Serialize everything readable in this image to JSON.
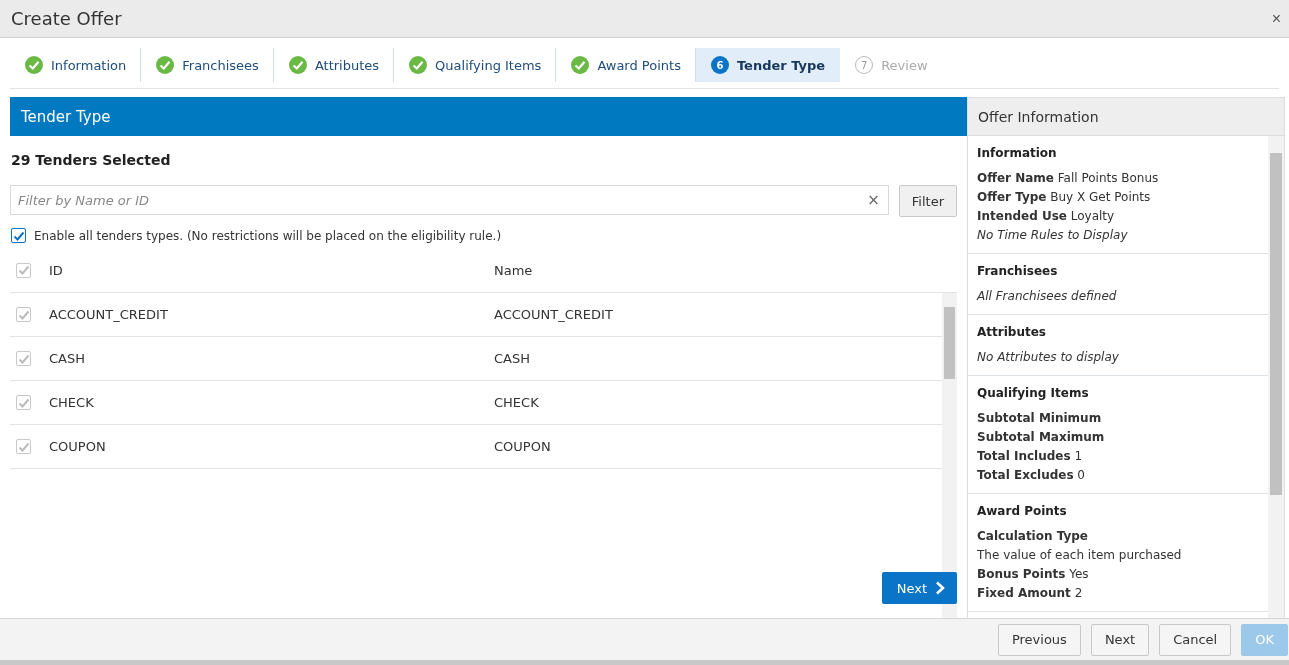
{
  "dialog": {
    "title": "Create Offer",
    "close": "×"
  },
  "steps": [
    {
      "label": "Information",
      "kind": "done",
      "selected": false
    },
    {
      "label": "Franchisees",
      "kind": "done",
      "selected": false
    },
    {
      "label": "Attributes",
      "kind": "done",
      "selected": false
    },
    {
      "label": "Qualifying Items",
      "kind": "done",
      "selected": false
    },
    {
      "label": "Award Points",
      "kind": "done",
      "selected": false
    },
    {
      "label": "Tender Type",
      "kind": "current",
      "number": "6",
      "selected": true
    },
    {
      "label": "Review",
      "kind": "pending",
      "number": "7",
      "selected": false
    }
  ],
  "main": {
    "header": "Tender Type",
    "count": "29 Tenders Selected",
    "filter": {
      "placeholder": "Filter by Name or ID",
      "clear": "×",
      "button": "Filter"
    },
    "enable_all": {
      "label": "Enable all tenders types. (No restrictions will be placed on the eligibility rule.)",
      "checked": true
    },
    "table": {
      "columns": [
        "ID",
        "Name"
      ],
      "header_checked": true,
      "rows": [
        {
          "id": "ACCOUNT_CREDIT",
          "name": "ACCOUNT_CREDIT",
          "checked": true
        },
        {
          "id": "CASH",
          "name": "CASH",
          "checked": true
        },
        {
          "id": "CHECK",
          "name": "CHECK",
          "checked": true
        },
        {
          "id": "COUPON",
          "name": "COUPON",
          "checked": true
        }
      ]
    },
    "next": "Next"
  },
  "offer_info": {
    "title": "Offer Information",
    "sections": [
      {
        "title": "Information",
        "lines": [
          {
            "kind": "pair",
            "label": "Offer Name",
            "value": "Fall Points Bonus"
          },
          {
            "kind": "pair",
            "label": "Offer Type",
            "value": "Buy X Get Points"
          },
          {
            "kind": "pair",
            "label": "Intended Use",
            "value": "Loyalty"
          },
          {
            "kind": "note",
            "text": "No Time Rules to Display"
          }
        ]
      },
      {
        "title": "Franchisees",
        "lines": [
          {
            "kind": "note",
            "text": "All Franchisees defined"
          }
        ]
      },
      {
        "title": "Attributes",
        "lines": [
          {
            "kind": "note",
            "text": "No Attributes to display"
          }
        ]
      },
      {
        "title": "Qualifying Items",
        "lines": [
          {
            "kind": "pair",
            "label": "Subtotal Minimum"
          },
          {
            "kind": "pair",
            "label": "Subtotal Maximum"
          },
          {
            "kind": "pair",
            "label": "Total Includes",
            "value": "1"
          },
          {
            "kind": "pair",
            "label": "Total Excludes",
            "value": "0"
          }
        ]
      },
      {
        "title": "Award Points",
        "lines": [
          {
            "kind": "pair",
            "label": "Calculation Type"
          },
          {
            "kind": "text",
            "text": "The value of each item purchased"
          },
          {
            "kind": "pair",
            "label": "Bonus Points",
            "value": "Yes"
          },
          {
            "kind": "pair",
            "label": "Fixed Amount",
            "value": "2"
          }
        ]
      }
    ]
  },
  "footer": [
    {
      "label": "Previous",
      "disabled": false
    },
    {
      "label": "Next",
      "disabled": false
    },
    {
      "label": "Cancel",
      "disabled": false
    },
    {
      "label": "OK",
      "disabled": true
    }
  ]
}
